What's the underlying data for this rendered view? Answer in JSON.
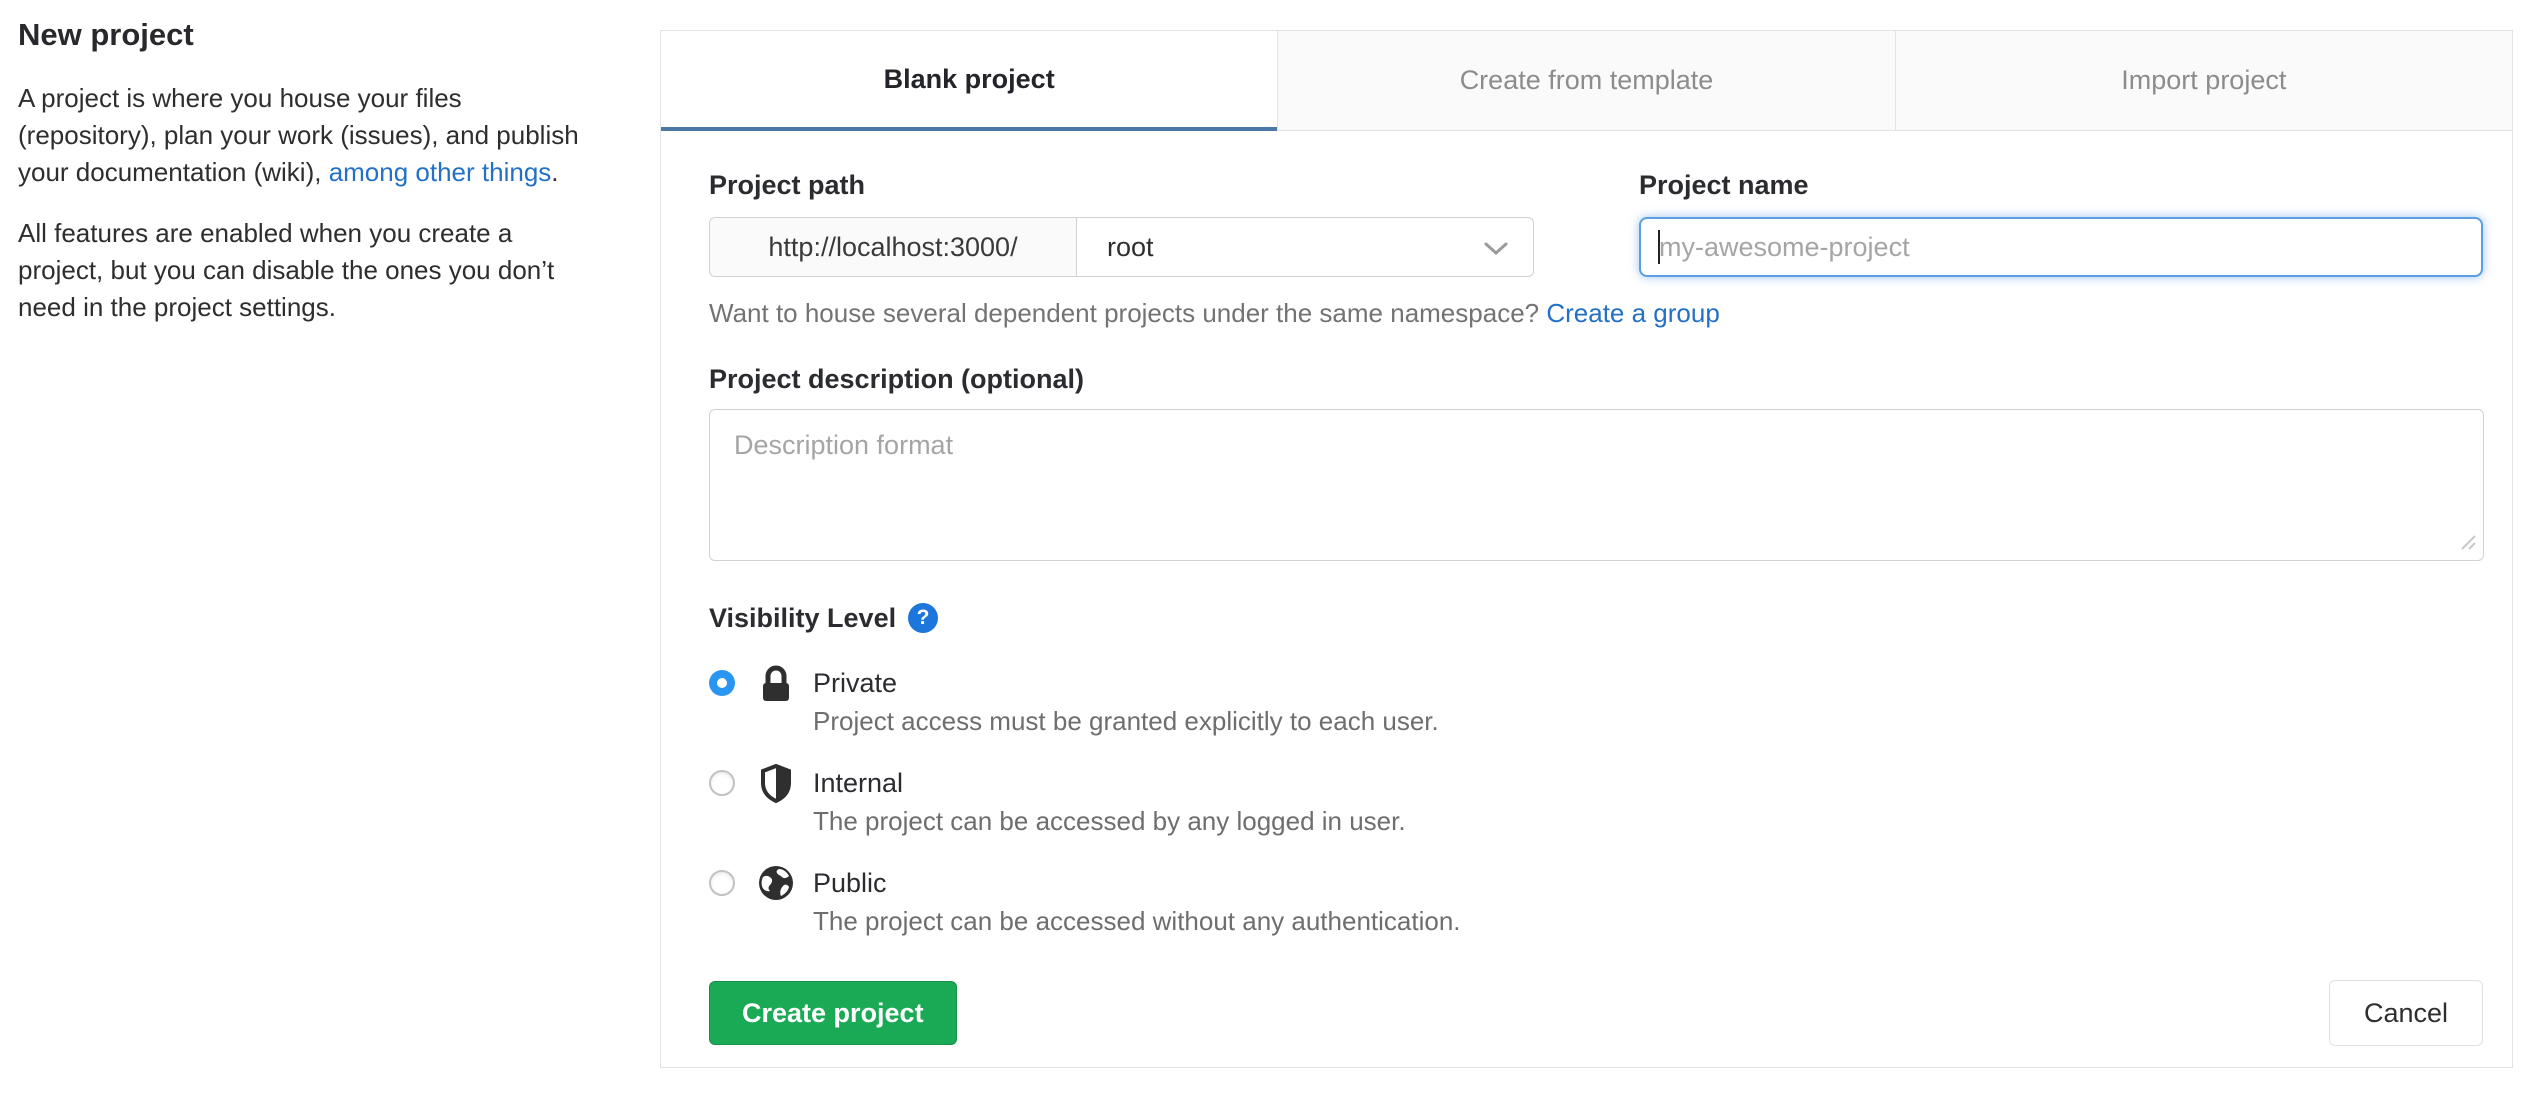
{
  "page": {
    "title": "New project",
    "intro": {
      "p1_pre": "A project is where you house your files (repository), plan your work (issues), and publish your documentation (wiki), ",
      "p1_link": "among other things",
      "p1_post": ".",
      "p2": "All features are enabled when you create a project, but you can disable the ones you don’t need in the project settings."
    }
  },
  "tabs": [
    {
      "label": "Blank project",
      "active": true
    },
    {
      "label": "Create from template",
      "active": false
    },
    {
      "label": "Import project",
      "active": false
    }
  ],
  "form": {
    "project_path": {
      "label": "Project path",
      "url_prefix": "http://localhost:3000/",
      "namespace_selected": "root"
    },
    "project_name": {
      "label": "Project name",
      "placeholder": "my-awesome-project",
      "value": ""
    },
    "namespace_hint": {
      "text": "Want to house several dependent projects under the same namespace? ",
      "link": "Create a group"
    },
    "description": {
      "label": "Project description (optional)",
      "placeholder": "Description format",
      "value": ""
    },
    "visibility": {
      "label": "Visibility Level",
      "help_glyph": "?",
      "options": [
        {
          "icon": "lock-icon",
          "label": "Private",
          "description": "Project access must be granted explicitly to each user.",
          "selected": true
        },
        {
          "icon": "shield-icon",
          "label": "Internal",
          "description": "The project can be accessed by any logged in user.",
          "selected": false
        },
        {
          "icon": "globe-icon",
          "label": "Public",
          "description": "The project can be accessed without any authentication.",
          "selected": false
        }
      ]
    },
    "buttons": {
      "submit": "Create project",
      "cancel": "Cancel"
    }
  },
  "colors": {
    "accent_tab_underline": "#4a79a8",
    "link_blue": "#2371c7",
    "help_icon_blue": "#1d76db",
    "radio_selected_blue": "#2b96f1",
    "submit_green": "#1aaa55",
    "focus_border_blue": "#5b9fe3"
  }
}
